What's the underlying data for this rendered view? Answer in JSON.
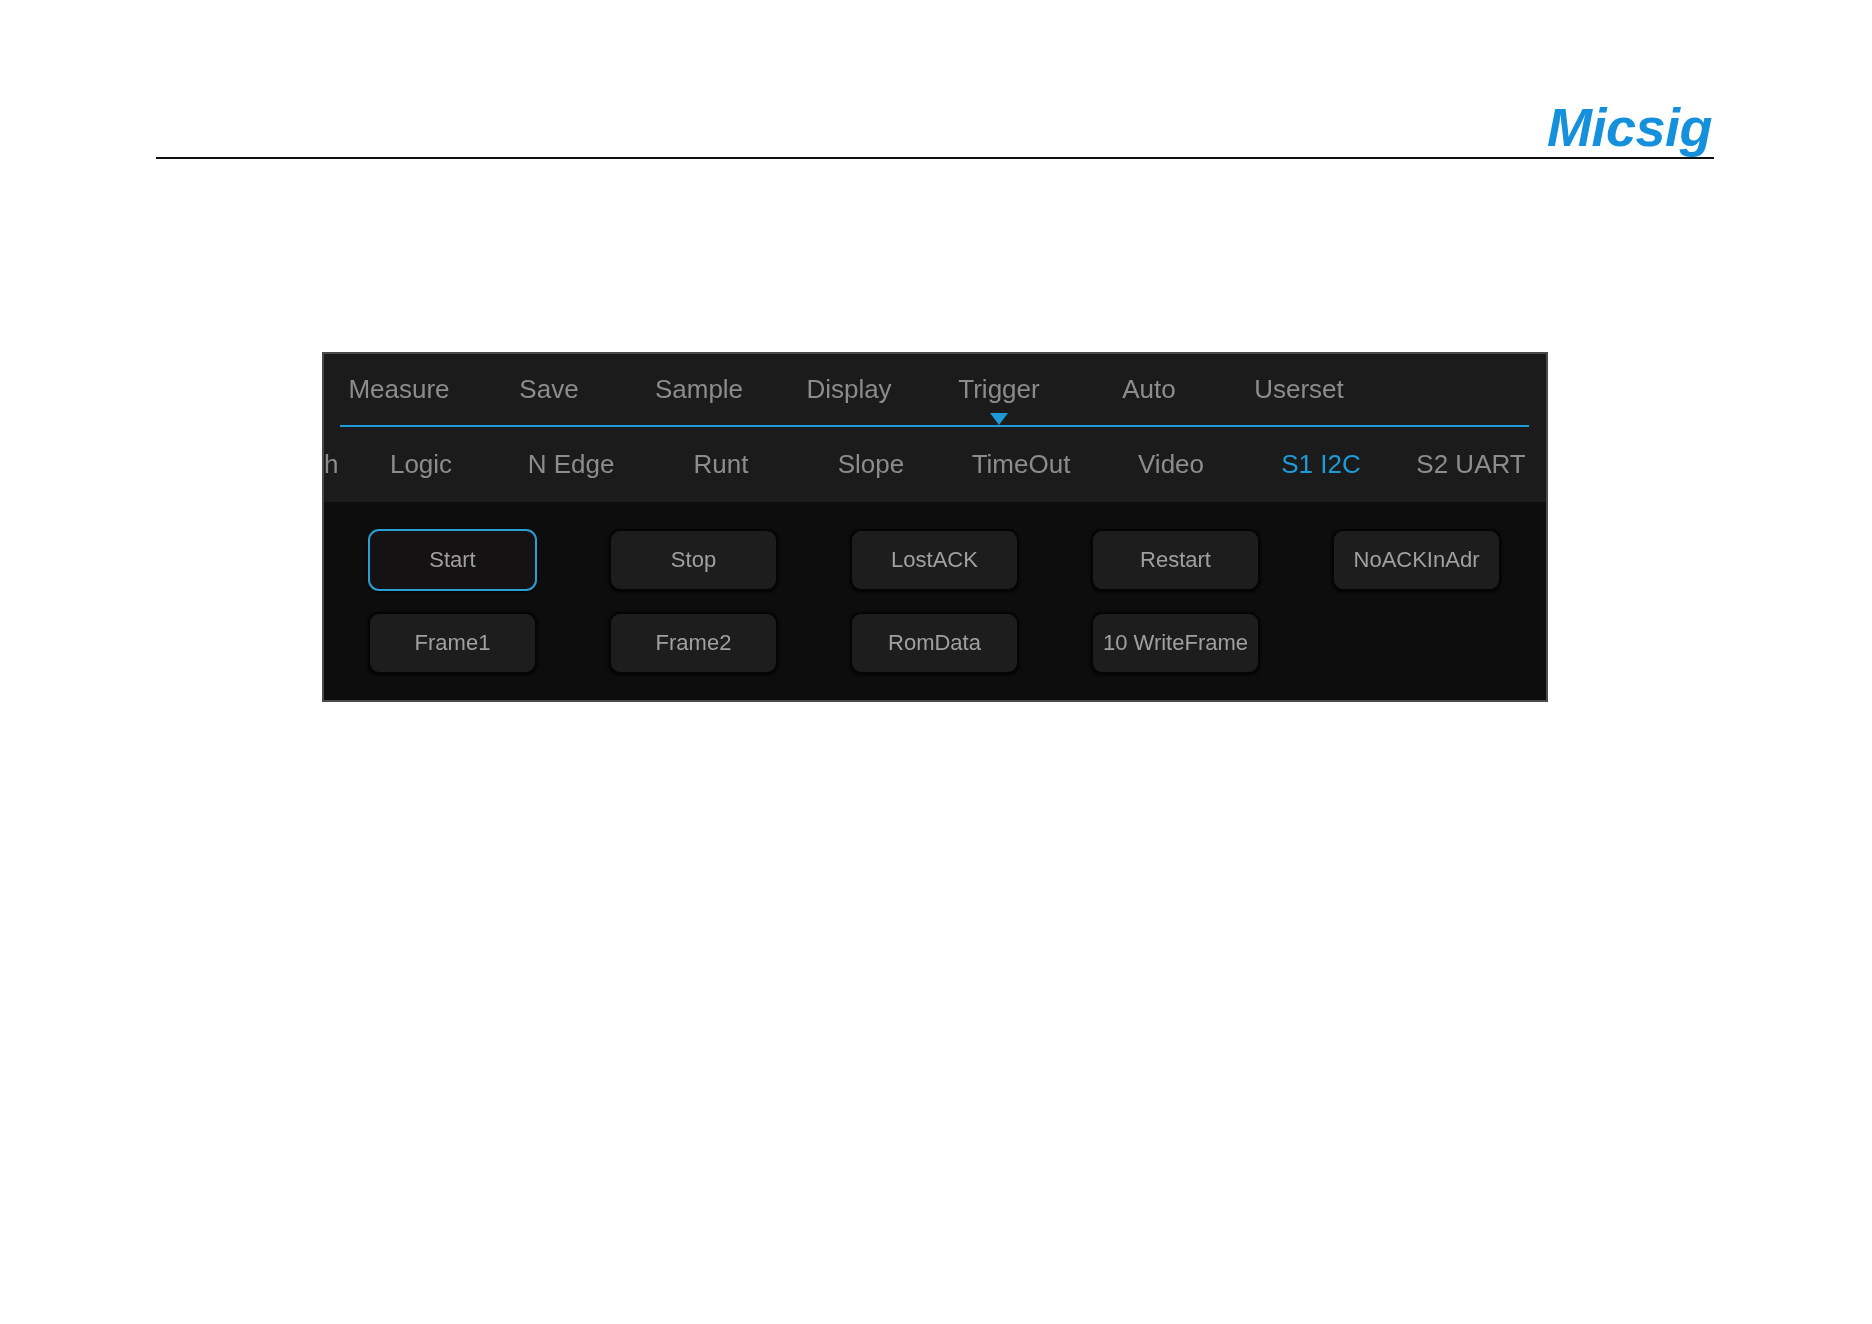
{
  "header": {
    "logo": "Micsig"
  },
  "menu": {
    "items": [
      {
        "label": "Measure",
        "selected": false
      },
      {
        "label": "Save",
        "selected": false
      },
      {
        "label": "Sample",
        "selected": false
      },
      {
        "label": "Display",
        "selected": false
      },
      {
        "label": "Trigger",
        "selected": true
      },
      {
        "label": "Auto",
        "selected": false
      },
      {
        "label": "Userset",
        "selected": false
      }
    ]
  },
  "trigger_types": {
    "items": [
      {
        "label": "h",
        "kind": "partial",
        "selected": false
      },
      {
        "label": "Logic",
        "kind": "full",
        "selected": false
      },
      {
        "label": "N Edge",
        "kind": "full",
        "selected": false
      },
      {
        "label": "Runt",
        "kind": "full",
        "selected": false
      },
      {
        "label": "Slope",
        "kind": "full",
        "selected": false
      },
      {
        "label": "TimeOut",
        "kind": "full",
        "selected": false
      },
      {
        "label": "Video",
        "kind": "full",
        "selected": false
      },
      {
        "label": "S1 I2C",
        "kind": "full",
        "selected": true
      },
      {
        "label": "S2 UART",
        "kind": "full",
        "selected": false
      }
    ]
  },
  "i2c_conditions": [
    {
      "label": "Start",
      "selected": true
    },
    {
      "label": "Stop",
      "selected": false
    },
    {
      "label": "LostACK",
      "selected": false
    },
    {
      "label": "Restart",
      "selected": false
    },
    {
      "label": "NoACKInAdr",
      "selected": false
    },
    {
      "label": "Frame1",
      "selected": false
    },
    {
      "label": "Frame2",
      "selected": false
    },
    {
      "label": "RomData",
      "selected": false
    },
    {
      "label": "10 WriteFrame",
      "selected": false
    }
  ]
}
